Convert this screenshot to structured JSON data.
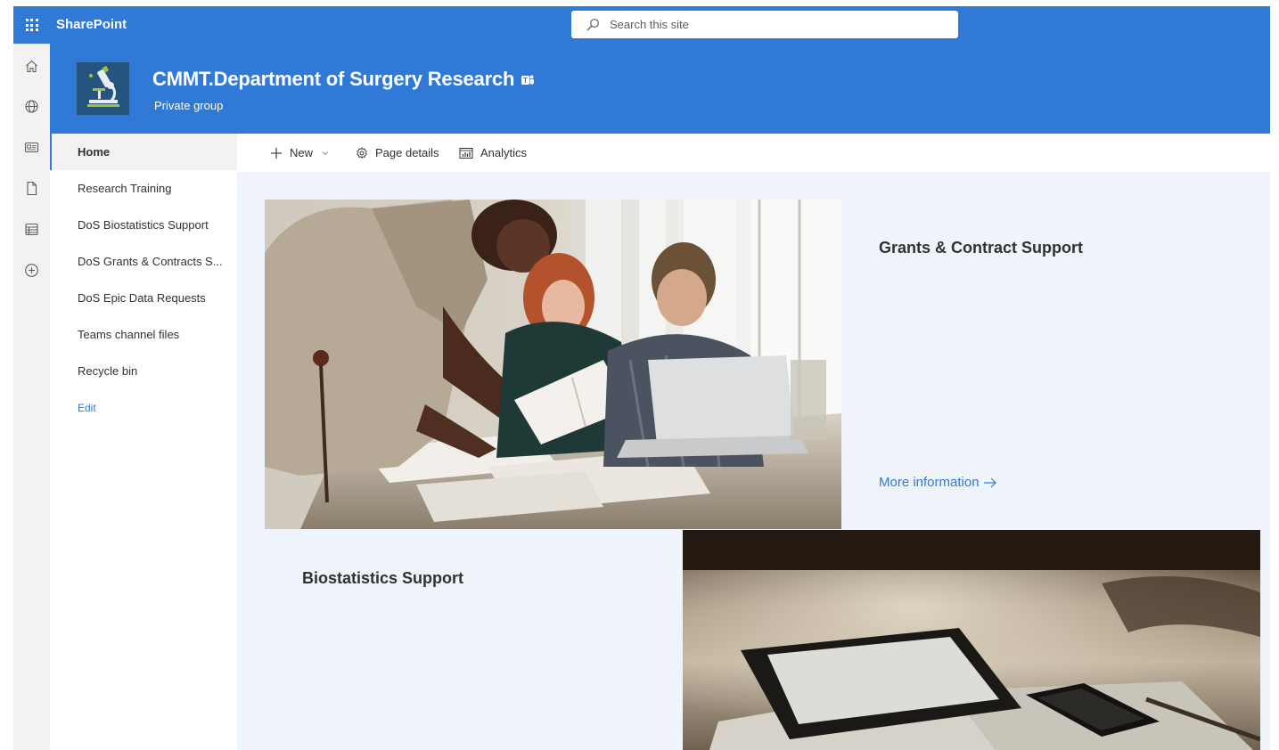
{
  "suitebar": {
    "app_name": "SharePoint",
    "search_placeholder": "Search this site"
  },
  "site": {
    "title": "CMMT.Department of Surgery Research",
    "subtitle": "Private group"
  },
  "nav": {
    "items": [
      {
        "label": "Home",
        "selected": true
      },
      {
        "label": "Research Training"
      },
      {
        "label": "DoS Biostatistics Support"
      },
      {
        "label": "DoS Grants & Contracts S..."
      },
      {
        "label": "DoS Epic Data Requests"
      },
      {
        "label": "Teams channel files"
      },
      {
        "label": "Recycle bin"
      }
    ],
    "edit_label": "Edit"
  },
  "commandbar": {
    "new_label": "New",
    "page_details_label": "Page details",
    "analytics_label": "Analytics"
  },
  "hero": {
    "tile1": {
      "title": "Grants & Contract Support",
      "link": "More information"
    },
    "tile2": {
      "title": "Biostatistics Support"
    }
  },
  "colors": {
    "theme": "#3079d6",
    "canvas": "#eff4fb",
    "rail": "#f3f2f1"
  }
}
